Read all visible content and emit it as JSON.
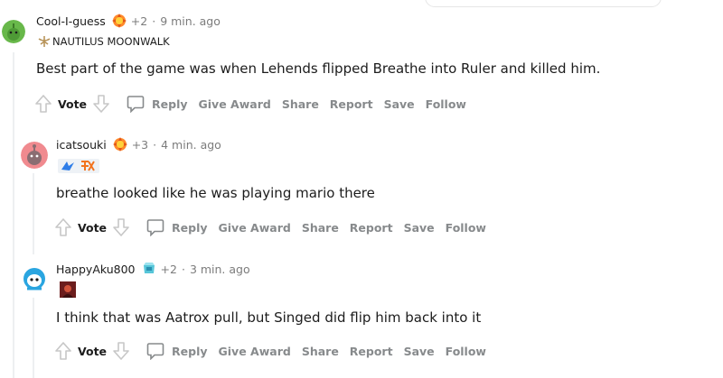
{
  "comments": [
    {
      "username": "Cool-I-guess",
      "points": "+2",
      "separator": "·",
      "time": "9 min. ago",
      "flair": "NAUTILUS MOONWALK",
      "body": "Best part of the game was when Lehends flipped Breathe into Ruler and killed him.",
      "avatar_color": "#68b84a"
    },
    {
      "username": "icatsouki",
      "points": "+3",
      "separator": "·",
      "time": "4 min. ago",
      "flair": "",
      "body": "breathe looked like he was playing mario there",
      "avatar_color": "#f08a8f"
    },
    {
      "username": "HappyAku800",
      "points": "+2",
      "separator": "·",
      "time": "3 min. ago",
      "flair": "",
      "body": "I think that was Aatrox pull, but Singed did flip him back into it",
      "avatar_color": "#2aa5e0"
    }
  ],
  "actions": {
    "vote": "Vote",
    "reply": "Reply",
    "give_award": "Give Award",
    "share": "Share",
    "report": "Report",
    "save": "Save",
    "follow": "Follow"
  },
  "icons": {
    "upvote": "upvote-arrow-icon",
    "downvote": "downvote-arrow-icon",
    "reply": "speech-bubble-icon",
    "award": "award-icon"
  },
  "colors": {
    "meta_gray": "#7c7c7c",
    "action_gray": "#878a8c",
    "thread_line": "#edeff1"
  }
}
